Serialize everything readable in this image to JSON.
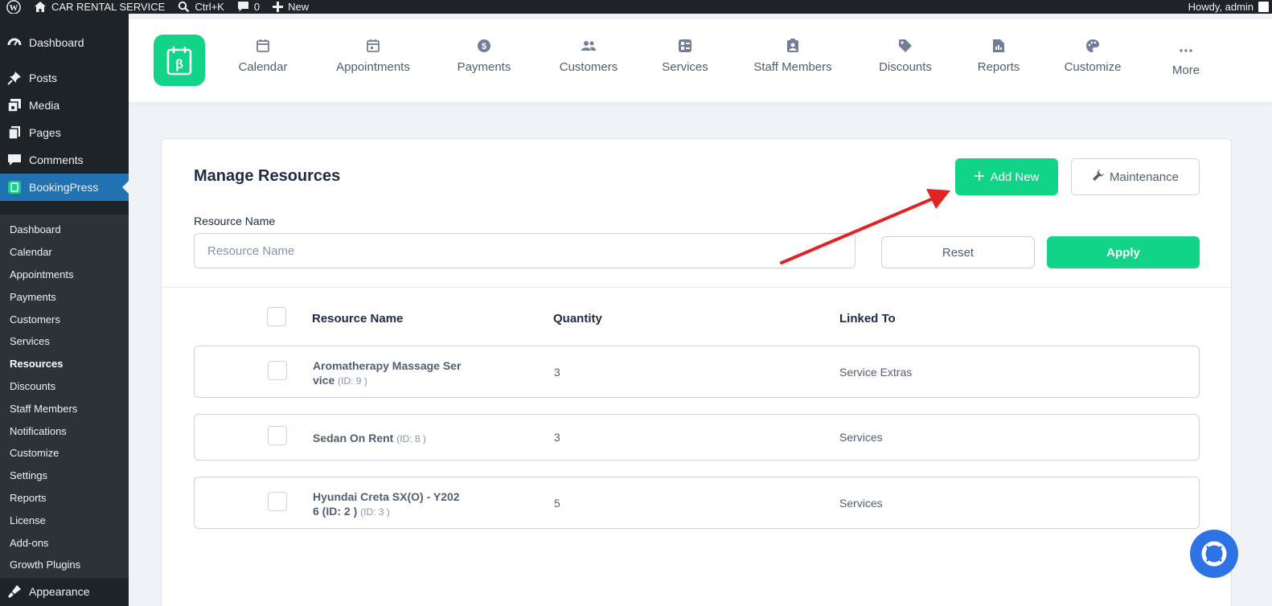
{
  "adminbar": {
    "site_name": "CAR RENTAL SERVICE",
    "search_shortcut": "Ctrl+K",
    "comments_count": "0",
    "new_label": "New",
    "howdy": "Howdy, admin"
  },
  "sidebar": {
    "top_items": [
      {
        "label": "Dashboard",
        "icon": "dashboard-icon"
      },
      {
        "label": "Posts",
        "icon": "pin-icon"
      },
      {
        "label": "Media",
        "icon": "media-icon"
      },
      {
        "label": "Pages",
        "icon": "pages-icon"
      },
      {
        "label": "Comments",
        "icon": "comment-icon"
      },
      {
        "label": "BookingPress",
        "icon": "bookingpress-icon"
      }
    ],
    "sub_items": [
      "Dashboard",
      "Calendar",
      "Appointments",
      "Payments",
      "Customers",
      "Services",
      "Resources",
      "Discounts",
      "Staff Members",
      "Notifications",
      "Customize",
      "Settings",
      "Reports",
      "License",
      "Add-ons",
      "Growth Plugins"
    ],
    "current_sub": "Resources",
    "bottom_item": {
      "label": "Appearance",
      "icon": "appearance-icon"
    }
  },
  "topnav": {
    "items": [
      {
        "label": "Calendar",
        "icon": "calendar-icon"
      },
      {
        "label": "Appointments",
        "icon": "calendar-check-icon"
      },
      {
        "label": "Payments",
        "icon": "dollar-icon"
      },
      {
        "label": "Customers",
        "icon": "users-icon"
      },
      {
        "label": "Services",
        "icon": "services-icon"
      },
      {
        "label": "Staff Members",
        "icon": "staff-badge-icon"
      },
      {
        "label": "Discounts",
        "icon": "tag-icon"
      },
      {
        "label": "Reports",
        "icon": "report-icon"
      },
      {
        "label": "Customize",
        "icon": "palette-icon"
      },
      {
        "label": "More",
        "icon": "more-dots-icon"
      }
    ]
  },
  "main": {
    "title": "Manage Resources",
    "add_new_label": "Add New",
    "maintenance_label": "Maintenance",
    "filter_label": "Resource Name",
    "filter_placeholder": "Resource Name",
    "reset_label": "Reset",
    "apply_label": "Apply",
    "columns": [
      "Resource Name",
      "Quantity",
      "Linked To"
    ],
    "rows": [
      {
        "name_line1": "Aromatherapy Massage Ser",
        "name_line2": "vice",
        "id": "(ID: 9 )",
        "quantity": "3",
        "linked_to": "Service Extras"
      },
      {
        "name_line1": "Sedan On Rent",
        "name_line2": "",
        "id": "(ID: 8 )",
        "quantity": "3",
        "linked_to": "Services"
      },
      {
        "name_line1": "Hyundai Creta SX(O) - Y202",
        "name_line2": "6 (ID: 2 )",
        "id": "(ID: 3 )",
        "quantity": "5",
        "linked_to": "Services"
      }
    ]
  },
  "colors": {
    "accent_green": "#12d488",
    "wp_dark": "#1d2327",
    "wp_blue": "#2271b1",
    "help_blue": "#2e73e6",
    "annotation_red": "#e02424"
  }
}
